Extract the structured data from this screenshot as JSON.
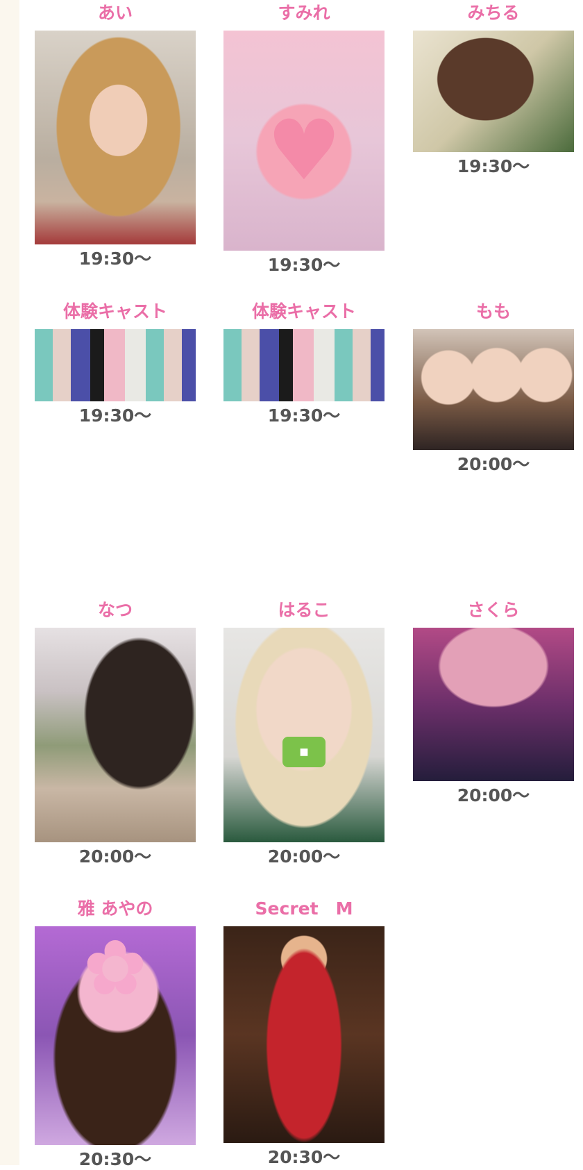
{
  "casts": [
    {
      "name": "あい",
      "time": "19:30〜",
      "photo": "portrait-photo"
    },
    {
      "name": "すみれ",
      "time": "19:30〜",
      "photo": "portrait-photo"
    },
    {
      "name": "みちる",
      "time": "19:30〜",
      "photo": "portrait-photo"
    },
    {
      "name": "体験キャスト",
      "time": "19:30〜",
      "photo": "group-photo"
    },
    {
      "name": "体験キャスト",
      "time": "19:30〜",
      "photo": "group-photo"
    },
    {
      "name": "もも",
      "time": "20:00〜",
      "photo": "group-photo"
    },
    {
      "name": "なつ",
      "time": "20:00〜",
      "photo": "portrait-photo"
    },
    {
      "name": "はるこ",
      "time": "20:00〜",
      "photo": "portrait-photo"
    },
    {
      "name": "さくら",
      "time": "20:00〜",
      "photo": "portrait-photo"
    },
    {
      "name": "雅 あやの",
      "time": "20:30〜",
      "photo": "portrait-photo"
    },
    {
      "name": "Secret　M",
      "time": "20:30〜",
      "photo": "portrait-photo"
    }
  ],
  "colors": {
    "name": "#ea6ea7",
    "time": "#555555",
    "left_strip": "#fbf7ee",
    "background": "#ffffff"
  }
}
